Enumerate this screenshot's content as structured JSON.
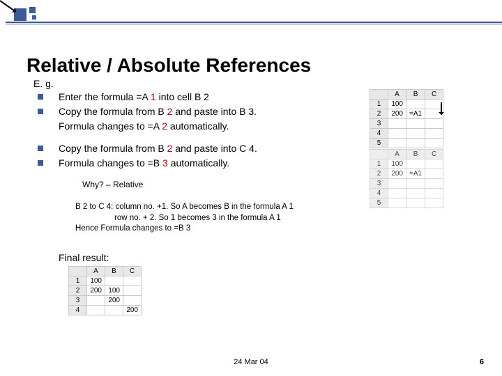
{
  "title": "Relative / Absolute References",
  "eg": "E. g.",
  "bullets_a": [
    {
      "pre": "Enter the formula =A ",
      "red": "1",
      "post": " into cell B 2"
    },
    {
      "pre": "Copy the formula from B ",
      "red": "2",
      "post": " and paste into B 3."
    },
    {
      "pre": "Formula changes to =A ",
      "red": "2",
      "post": " automatically."
    }
  ],
  "bullets_b": [
    {
      "pre": "Copy the formula from B ",
      "red": "2",
      "post": " and paste into C 4."
    },
    {
      "pre": "Formula changes to =B ",
      "red": "3",
      "post": " automatically."
    }
  ],
  "why": "Why? – Relative",
  "explain_l1": "B 2 to C 4: column no. +1. So A becomes B in the formula A 1",
  "explain_l2": "row no. + 2. So 1 becomes 3 in the formula A 1",
  "explain_l3": "Hence Formula changes to =B 3",
  "final": "Final result:",
  "sheet_headers": [
    "",
    "A",
    "B",
    "C"
  ],
  "sheet1_rows": [
    [
      "1",
      "100",
      "",
      ""
    ],
    [
      "2",
      "200",
      "=A1",
      ""
    ],
    [
      "3",
      "",
      "",
      ""
    ],
    [
      "4",
      "",
      "",
      ""
    ],
    [
      "5",
      "",
      "",
      ""
    ]
  ],
  "sheet2_rows": [
    [
      "1",
      "100",
      "",
      ""
    ],
    [
      "2",
      "200",
      "=A1",
      ""
    ],
    [
      "3",
      "",
      "",
      ""
    ],
    [
      "4",
      "",
      "",
      ""
    ],
    [
      "5",
      "",
      "",
      ""
    ]
  ],
  "sheet3_rows": [
    [
      "1",
      "100",
      "",
      ""
    ],
    [
      "2",
      "200",
      "100",
      ""
    ],
    [
      "3",
      "",
      "200",
      ""
    ],
    [
      "4",
      "",
      "",
      "200"
    ]
  ],
  "footer_date": "24 Mar 04",
  "footer_num": "6"
}
